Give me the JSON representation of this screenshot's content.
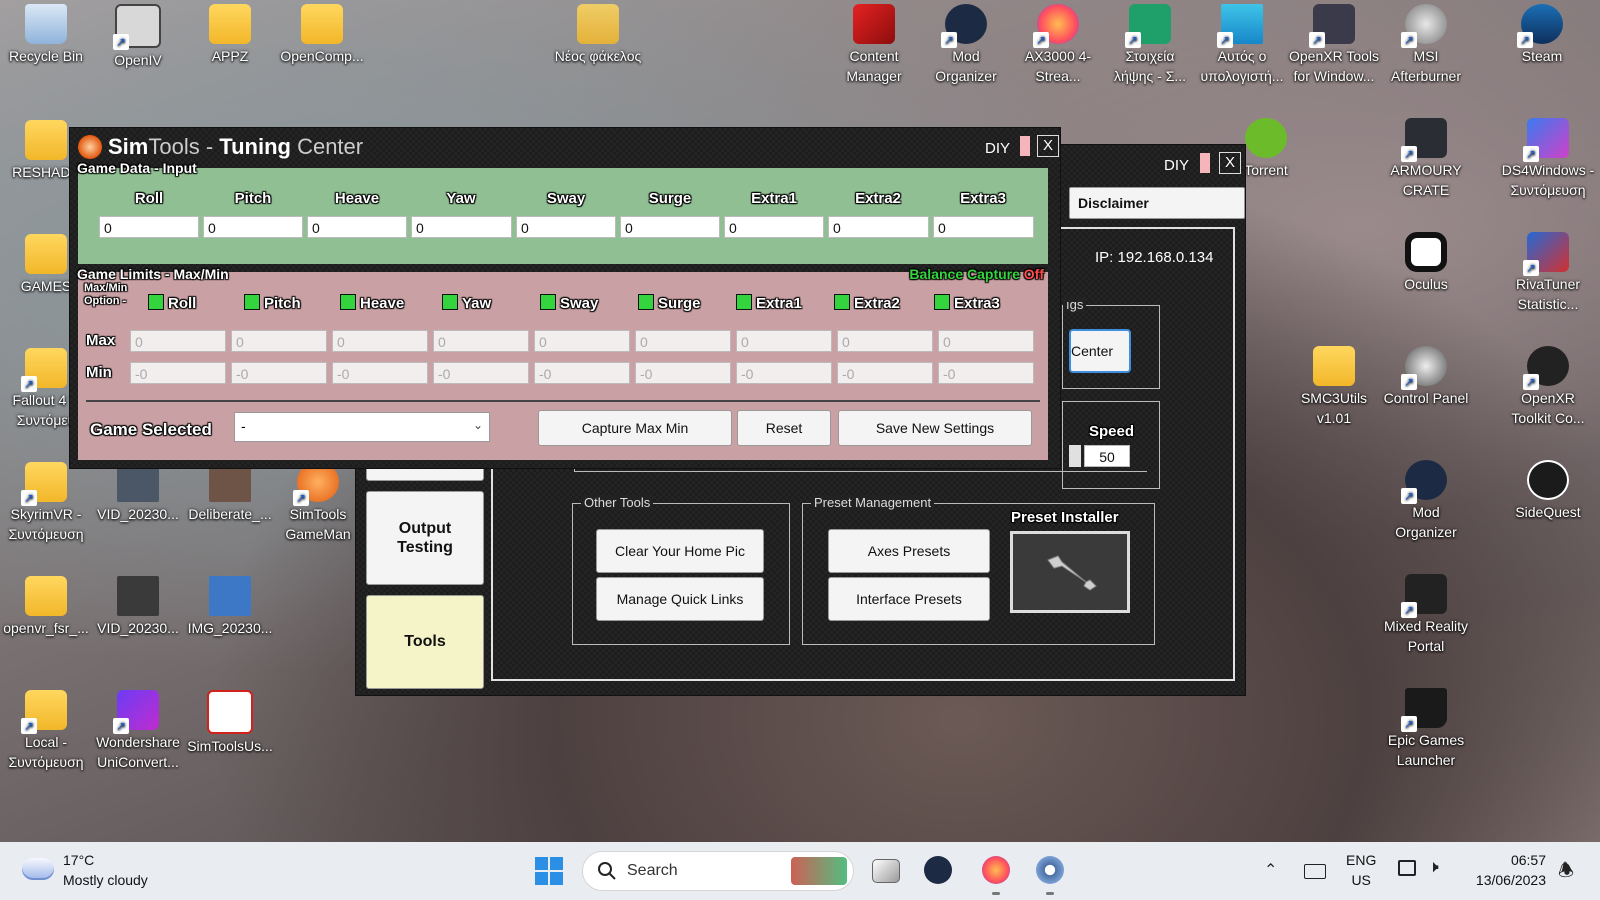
{
  "desktop": {
    "icons": [
      {
        "label": "Recycle Bin"
      },
      {
        "label": "OpenIV"
      },
      {
        "label": "APPZ"
      },
      {
        "label": "OpenComp..."
      },
      {
        "label": "Νέος φάκελος"
      },
      {
        "label": "Content Manager"
      },
      {
        "label": "Mod Organizer"
      },
      {
        "label": "AX3000 4-Strea..."
      },
      {
        "label": "Στοιχεία λήψης - Σ..."
      },
      {
        "label": "Αυτός ο υπολογιστή..."
      },
      {
        "label": "OpenXR Tools for Window..."
      },
      {
        "label": "MSI Afterburner"
      },
      {
        "label": "Steam"
      },
      {
        "label": "RESHADE"
      },
      {
        "label": "Torrent"
      },
      {
        "label": "ARMOURY CRATE"
      },
      {
        "label": "DS4Windows - Συντόμευση"
      },
      {
        "label": "GAMES"
      },
      {
        "label": "Oculus"
      },
      {
        "label": "RivaTuner Statistic..."
      },
      {
        "label": "Fallout 4 V Συντόμευ"
      },
      {
        "label": "SMC3Utils v1.01"
      },
      {
        "label": "Control Panel"
      },
      {
        "label": "OpenXR Toolkit Co..."
      },
      {
        "label": "SkyrimVR - Συντόμευση"
      },
      {
        "label": "VID_20230..."
      },
      {
        "label": "Deliberate_..."
      },
      {
        "label": "SimTools GameMan"
      },
      {
        "label": "Mod Organizer"
      },
      {
        "label": "SideQuest"
      },
      {
        "label": "openvr_fsr_..."
      },
      {
        "label": "VID_20230..."
      },
      {
        "label": "IMG_20230..."
      },
      {
        "label": "Mixed Reality Portal"
      },
      {
        "label": "Local - Συντόμευση"
      },
      {
        "label": "Wondershare UniConvert..."
      },
      {
        "label": "SimToolsUs..."
      },
      {
        "label": "Epic Games Launcher"
      }
    ]
  },
  "back_window": {
    "diy_label": "DIY",
    "close_label": "X",
    "disclaimer_label": "Disclaimer",
    "ip_text": "IP: 192.168.0.134",
    "settings_group_label": "ıgs",
    "center_button": "Center",
    "speed_label": "Speed",
    "speed_value": "50",
    "output_testing_button": "Output Testing",
    "tools_button": "Tools",
    "other_tools": {
      "label": "Other Tools",
      "clear_home_pic": "Clear Your Home Pic",
      "manage_quick_links": "Manage Quick Links"
    },
    "preset_management": {
      "label": "Preset Management",
      "axes_presets": "Axes Presets",
      "interface_presets": "Interface Presets"
    },
    "preset_installer_label": "Preset Installer"
  },
  "tuning_window": {
    "title_sim": "Sim",
    "title_tools": "Tools",
    "title_dash": " - ",
    "title_tuning": "Tuning",
    "title_center": " Center",
    "diy_label": "DIY",
    "close_label": "X",
    "game_data_label": "Game Data - Input",
    "axes": [
      "Roll",
      "Pitch",
      "Heave",
      "Yaw",
      "Sway",
      "Surge",
      "Extra1",
      "Extra2",
      "Extra3"
    ],
    "input_values": [
      "0",
      "0",
      "0",
      "0",
      "0",
      "0",
      "0",
      "0",
      "0"
    ],
    "game_limits_label": "Game Limits - Max/Min",
    "balance_capture_label": "Balance Capture",
    "balance_capture_state": "Off",
    "maxmin_option_line1": "Max/Min",
    "maxmin_option_line2": "Option -",
    "max_label": "Max",
    "min_label": "Min",
    "max_values": [
      "0",
      "0",
      "0",
      "0",
      "0",
      "0",
      "0",
      "0",
      "0"
    ],
    "min_values": [
      "-0",
      "-0",
      "-0",
      "-0",
      "-0",
      "-0",
      "-0",
      "-0",
      "-0"
    ],
    "game_selected_label": "Game Selected",
    "game_selected_value": "-",
    "capture_max_min_button": "Capture Max Min",
    "reset_button": "Reset",
    "save_new_settings_button": "Save New Settings"
  },
  "taskbar": {
    "weather_temp": "17°C",
    "weather_desc": "Mostly cloudy",
    "search_placeholder": "Search",
    "lang_line1": "ENG",
    "lang_line2": "US",
    "time": "06:57",
    "date": "13/06/2023"
  },
  "colors": {
    "game_data_bg": "#8fbf92",
    "game_limits_bg": "#c9a0a3",
    "tools_button_bg": "#f4f4c8",
    "checkbox_green": "#33d43e",
    "balance_capture_color": "#33d43e",
    "balance_off_color": "#ff4a4a"
  }
}
